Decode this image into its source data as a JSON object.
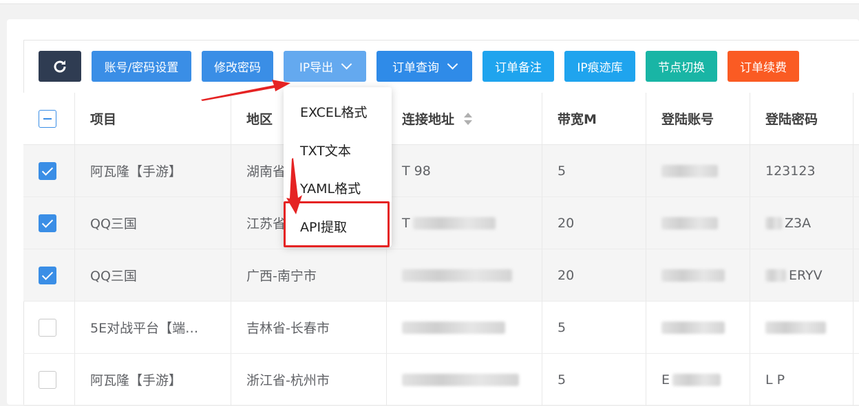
{
  "toolbar": {
    "refresh_icon": "refresh-icon",
    "account_settings": "账号/密码设置",
    "change_password": "修改密码",
    "ip_export": "IP导出",
    "order_query": "订单查询",
    "order_note": "订单备注",
    "ip_trace_lib": "IP痕迹库",
    "node_switch": "节点切换",
    "order_renew": "订单续费"
  },
  "dropdown": {
    "items": [
      "EXCEL格式",
      "TXT文本",
      "YAML格式",
      "API提取"
    ],
    "highlighted": "API提取"
  },
  "table": {
    "headers": [
      "项目",
      "地区",
      "连接地址",
      "带宽M",
      "登陆账号",
      "登陆密码"
    ],
    "rows": [
      {
        "checked": true,
        "project": "阿瓦隆【手游】",
        "region": "湖南省",
        "address": "T 98",
        "bandwidth": "5",
        "account": "",
        "password": "123123"
      },
      {
        "checked": true,
        "project": "QQ三国",
        "region": "江苏省",
        "address": "T",
        "bandwidth": "20",
        "account": "",
        "password": "Z3A"
      },
      {
        "checked": true,
        "project": "QQ三国",
        "region": "广西-南宁市",
        "address": "",
        "bandwidth": "20",
        "account": "",
        "password": "ERYV"
      },
      {
        "checked": false,
        "project": "5E对战平台【端…",
        "region": "吉林省-长春市",
        "address": "",
        "bandwidth": "5",
        "account": "",
        "password": ""
      },
      {
        "checked": false,
        "project": "阿瓦隆【手游】",
        "region": "浙江省-杭州市",
        "address": "",
        "bandwidth": "5",
        "account": "E",
        "password": "L P"
      }
    ]
  },
  "colors": {
    "primary": "#3a8ee6",
    "dark": "#2f3c52",
    "teal": "#19b5a5",
    "orange": "#fa5b23",
    "annotation_red": "#e52323"
  }
}
